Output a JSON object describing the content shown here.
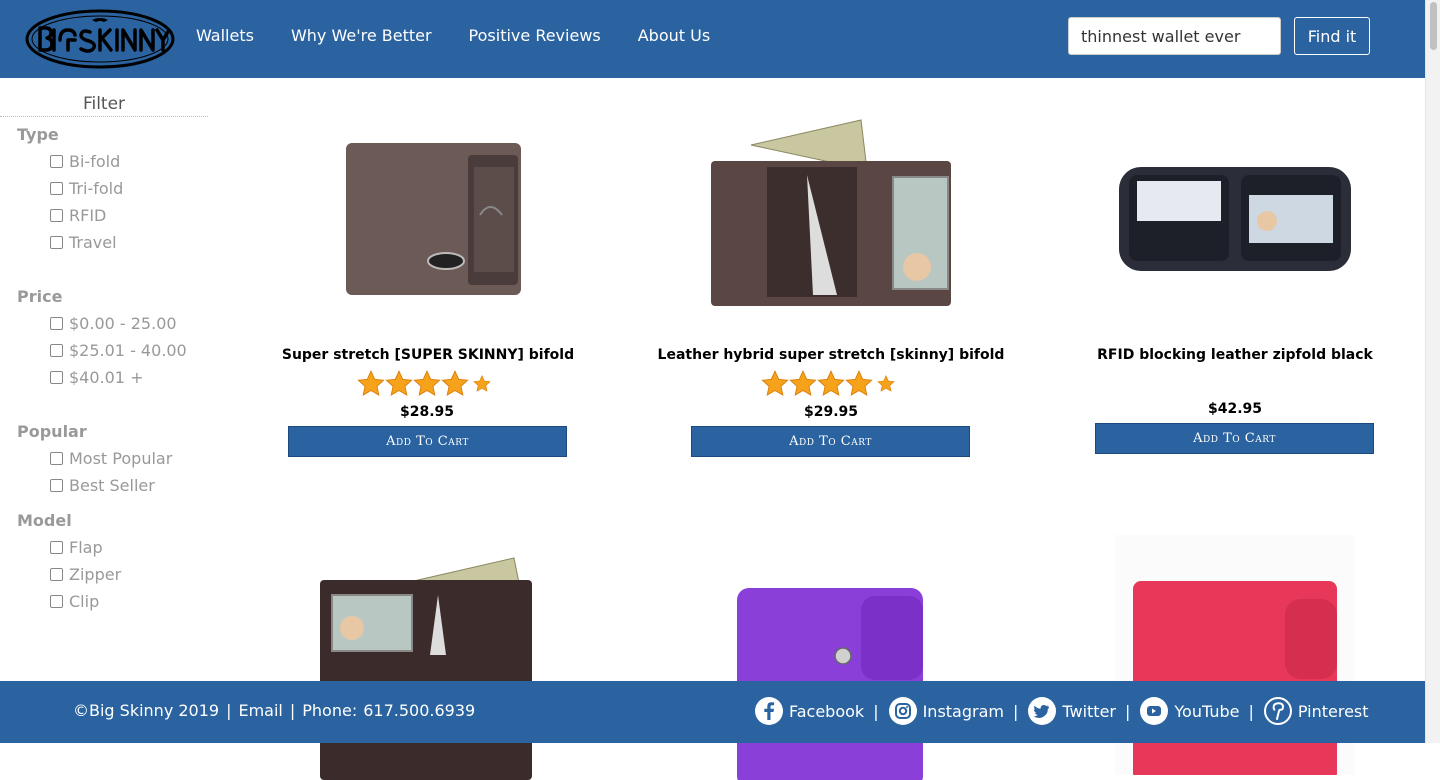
{
  "brand": {
    "logo_text": "BiG SKiNNY"
  },
  "nav": {
    "items": [
      {
        "label": "Wallets"
      },
      {
        "label": "Why We're Better"
      },
      {
        "label": "Positive Reviews"
      },
      {
        "label": "About Us"
      }
    ]
  },
  "search": {
    "value": "thinnest wallet ever",
    "button_label": "Find it"
  },
  "sidebar": {
    "title": "Filter",
    "groups": [
      {
        "title": "Type",
        "options": [
          "Bi-fold",
          "Tri-fold",
          "RFID",
          "Travel"
        ]
      },
      {
        "title": "Price",
        "options": [
          "$0.00 - 25.00",
          "$25.01 - 40.00",
          "$40.01 +"
        ]
      },
      {
        "title": "Popular",
        "options": [
          "Most Popular",
          "Best Seller"
        ]
      },
      {
        "title": "Model",
        "options": [
          "Flap",
          "Zipper",
          "Clip"
        ]
      }
    ]
  },
  "products": [
    {
      "name": "Super stretch [SUPER SKINNY] bifold",
      "rating": 4.5,
      "price": "$28.95",
      "cart_label": "Add To Cart",
      "color": "#6b5a56"
    },
    {
      "name": "Leather hybrid super stretch [skinny] bifold",
      "rating": 4.5,
      "price": "$29.95",
      "cart_label": "Add To Cart",
      "color": "#5a4642"
    },
    {
      "name": "RFID blocking leather zipfold black",
      "rating": 0,
      "price": "$42.95",
      "cart_label": "Add To Cart",
      "color": "#2b2d38"
    },
    {
      "name": "",
      "color": "#3b2b2a"
    },
    {
      "name": "",
      "color": "#8a3fd8"
    },
    {
      "name": "",
      "color": "#e8385a"
    }
  ],
  "footer": {
    "copyright": "©Big Skinny 2019",
    "email_label": "Email",
    "phone_label": "Phone:",
    "phone_value": "617.500.6939",
    "social": [
      {
        "label": "Facebook",
        "icon": "facebook-icon"
      },
      {
        "label": "Instagram",
        "icon": "instagram-icon"
      },
      {
        "label": "Twitter",
        "icon": "twitter-icon"
      },
      {
        "label": "YouTube",
        "icon": "youtube-icon"
      },
      {
        "label": "Pinterest",
        "icon": "pinterest-icon"
      }
    ]
  },
  "colors": {
    "primary": "#2a63a0",
    "star": "#f7a21b"
  }
}
